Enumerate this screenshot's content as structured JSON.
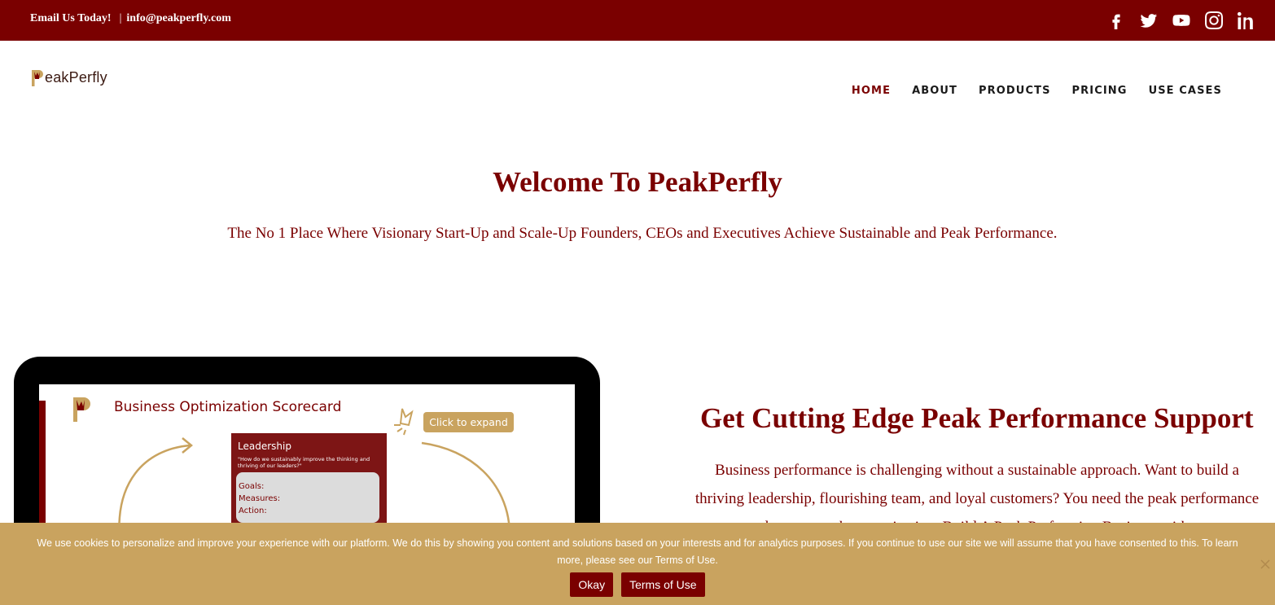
{
  "topbar": {
    "email_label": "Email Us Today!",
    "separator": "|",
    "email": "info@peakperfly.com",
    "social_icons": [
      "facebook-icon",
      "twitter-icon",
      "youtube-icon",
      "instagram-icon",
      "linkedin-icon"
    ]
  },
  "header": {
    "logo_text": "eakPerfly",
    "nav": [
      {
        "label": "HOME",
        "active": true
      },
      {
        "label": "ABOUT",
        "active": false
      },
      {
        "label": "PRODUCTS",
        "active": false
      },
      {
        "label": "PRICING",
        "active": false
      },
      {
        "label": "USE CASES",
        "active": false
      }
    ]
  },
  "hero": {
    "title": "Welcome To PeakPerfly",
    "subtitle": "The No 1 Place Where Visionary Start-Up and Scale-Up Founders, CEOs and Executives Achieve Sustainable and Peak Performance."
  },
  "scorecard": {
    "title": "Business Optimization Scorecard",
    "expand_label": "Click to expand",
    "card_heading": "Leadership",
    "card_question": "\"How do we sustainably improve the thinking and thriving of our leaders?\"",
    "fields": [
      "Goals:",
      "Measures:",
      "Action:"
    ]
  },
  "support": {
    "title": "Get Cutting Edge Peak Performance Support",
    "body": "Business performance is challenging without a sustainable approach. Want to build a thriving leadership, flourishing team, and loyal customers? You need the peak performance boost your the organization. Build A Peak Performing Business with"
  },
  "cookie": {
    "message": "We use cookies to personalize and improve your experience with our platform. We do this by showing you content and solutions based on your interests and for analytics purposes. If you continue to use our site we will assume that you have consented to this. To learn more, please see our Terms of Use.",
    "ok_label": "Okay",
    "terms_label": "Terms of Use"
  },
  "colors": {
    "brand": "#7a0000",
    "gold": "#c9a35f"
  }
}
